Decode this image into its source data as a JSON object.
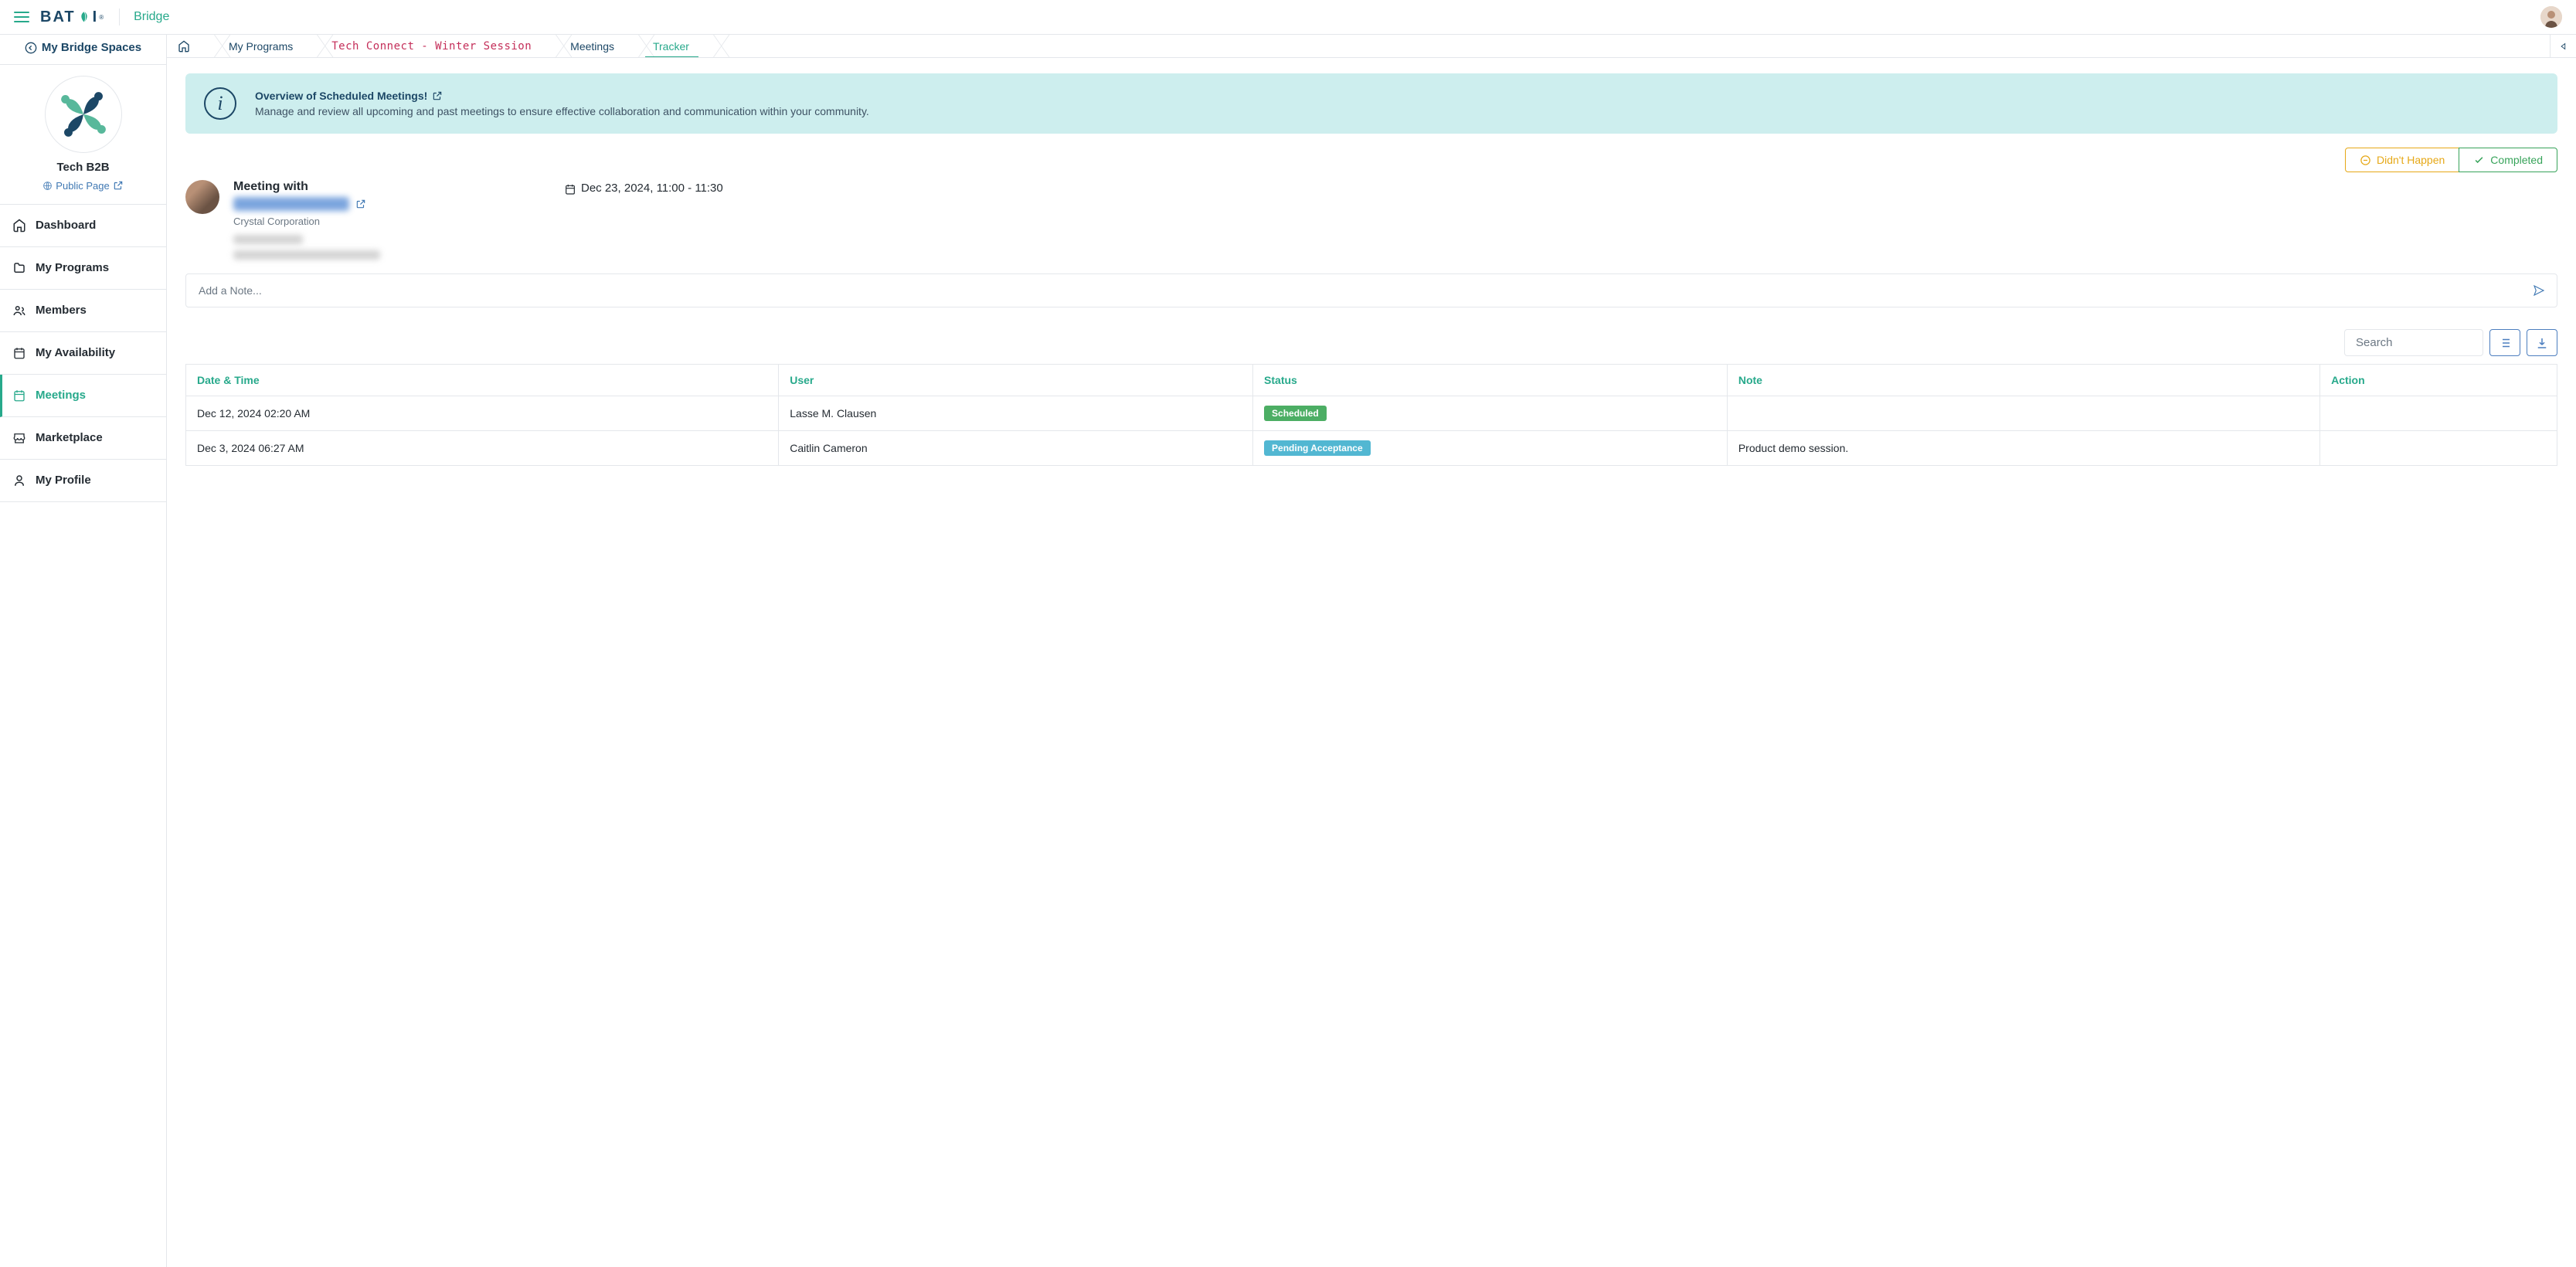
{
  "header": {
    "logo_text_left": "BAT",
    "logo_text_right": "I",
    "logo_sup": "®",
    "app_name": "Bridge"
  },
  "sidebar": {
    "back_label": "My Bridge Spaces",
    "org_name": "Tech B2B",
    "public_page_label": "Public Page",
    "nav": {
      "dashboard": "Dashboard",
      "programs": "My Programs",
      "members": "Members",
      "availability": "My Availability",
      "meetings": "Meetings",
      "marketplace": "Marketplace",
      "profile": "My Profile"
    }
  },
  "breadcrumb": {
    "programs": "My Programs",
    "program_name": "Tech Connect - Winter Session",
    "meetings": "Meetings",
    "tracker": "Tracker"
  },
  "banner": {
    "title": "Overview of Scheduled Meetings!",
    "subtitle": "Manage and review all upcoming and past meetings to ensure effective collaboration and communication within your community."
  },
  "status_buttons": {
    "didnt_happen": "Didn't Happen",
    "completed": "Completed"
  },
  "meeting": {
    "prefix": "Meeting with",
    "org": "Crystal Corporation",
    "datetime": "Dec 23, 2024, 11:00 - 11:30"
  },
  "note_input": {
    "placeholder": "Add a Note..."
  },
  "table": {
    "search_placeholder": "Search",
    "columns": {
      "datetime": "Date & Time",
      "user": "User",
      "status": "Status",
      "note": "Note",
      "action": "Action"
    },
    "rows": [
      {
        "datetime": "Dec 12, 2024 02:20 AM",
        "user": "Lasse M. Clausen",
        "status_label": "Scheduled",
        "status_kind": "scheduled",
        "note": ""
      },
      {
        "datetime": "Dec 3, 2024 06:27 AM",
        "user": "Caitlin Cameron",
        "status_label": "Pending Acceptance",
        "status_kind": "pending",
        "note": "Product demo session."
      }
    ]
  }
}
